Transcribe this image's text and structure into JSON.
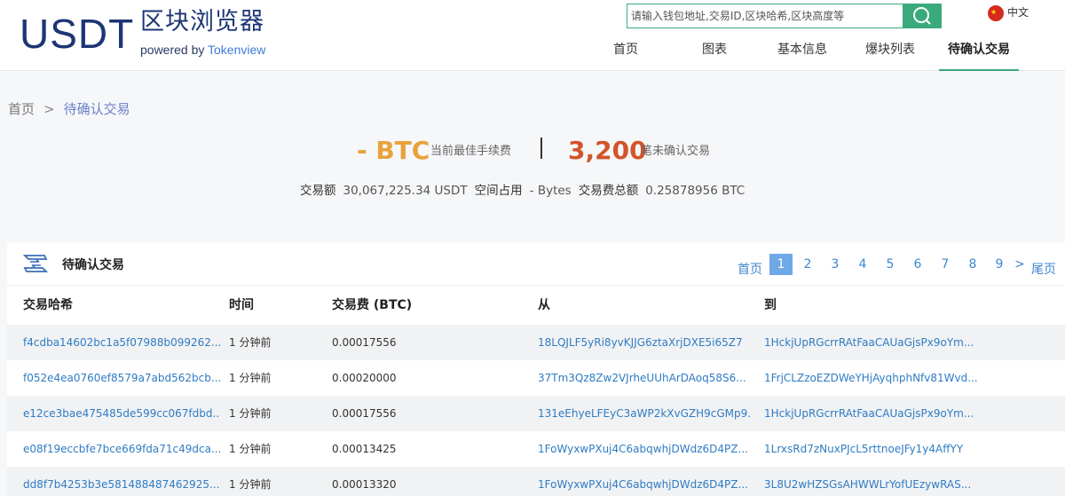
{
  "logo": {
    "main": "USDT",
    "cn": "区块浏览器",
    "powered_prefix": "powered by ",
    "powered_brand": "Tokenview"
  },
  "search": {
    "placeholder": "请输入钱包地址,交易ID,区块哈希,区块高度等"
  },
  "lang": {
    "label": "中文"
  },
  "nav": [
    "首页",
    "图表",
    "基本信息",
    "爆块列表",
    "待确认交易"
  ],
  "breadcrumb": {
    "home": "首页",
    "sep": ">",
    "current": "待确认交易"
  },
  "stats": {
    "fee_value": "- BTC",
    "fee_label": "当前最佳手续费",
    "count_value": "3,200",
    "count_label": "笔未确认交易",
    "amount_label": "交易额",
    "amount_value": "30,067,225.34 USDT",
    "space_label": "空间占用",
    "space_value": "- Bytes",
    "totalfee_label": "交易费总额",
    "totalfee_value": "0.25878956 BTC"
  },
  "panel": {
    "title": "待确认交易"
  },
  "pager": {
    "first": "首页",
    "pages": [
      "1",
      "2",
      "3",
      "4",
      "5",
      "6",
      "7",
      "8",
      "9"
    ],
    "next": ">",
    "last": "尾页",
    "current": "1"
  },
  "table": {
    "headers": [
      "交易哈希",
      "时间",
      "交易费 (BTC)",
      "从",
      "到"
    ],
    "rows": [
      {
        "hash": "f4cdba14602bc1a5f07988b099262...",
        "time": "1 分钟前",
        "fee": "0.00017556",
        "from": "18LQJLF5yRi8yvKJJG6ztaXrjDXE5i65Z7",
        "to": "1HckjUpRGcrrRAtFaaCAUaGjsPx9oYm..."
      },
      {
        "hash": "f052e4ea0760ef8579a7abd562bcb...",
        "time": "1 分钟前",
        "fee": "0.00020000",
        "from": "37Tm3Qz8Zw2VJrheUUhArDAoq58S6...",
        "to": "1FrjCLZzoEZDWeYHjAyqhphNfv81Wvd..."
      },
      {
        "hash": "e12ce3bae475485de599cc067fdbd...",
        "time": "1 分钟前",
        "fee": "0.00017556",
        "from": "131eEhyeLFEyC3aWP2kXvGZH9cGMp9...",
        "to": "1HckjUpRGcrrRAtFaaCAUaGjsPx9oYm..."
      },
      {
        "hash": "e08f19eccbfe7bce669fda71c49dca...",
        "time": "1 分钟前",
        "fee": "0.00013425",
        "from": "1FoWyxwPXuj4C6abqwhjDWdz6D4PZ...",
        "to": "1LrxsRd7zNuxPJcL5rttnoeJFy1y4AffYY"
      },
      {
        "hash": "dd8f7b4253b3e581488487462925...",
        "time": "1 分钟前",
        "fee": "0.00013320",
        "from": "1FoWyxwPXuj4C6abqwhjDWdz6D4PZ...",
        "to": "3L8U2wHZSGsAHWWLrYofUEzywRAS..."
      }
    ]
  },
  "colors": {
    "brand": "#1c3574",
    "accent": "#3aaa7d",
    "fee": "#e8a23c",
    "count": "#d2552a",
    "link": "#2f7cc4"
  }
}
